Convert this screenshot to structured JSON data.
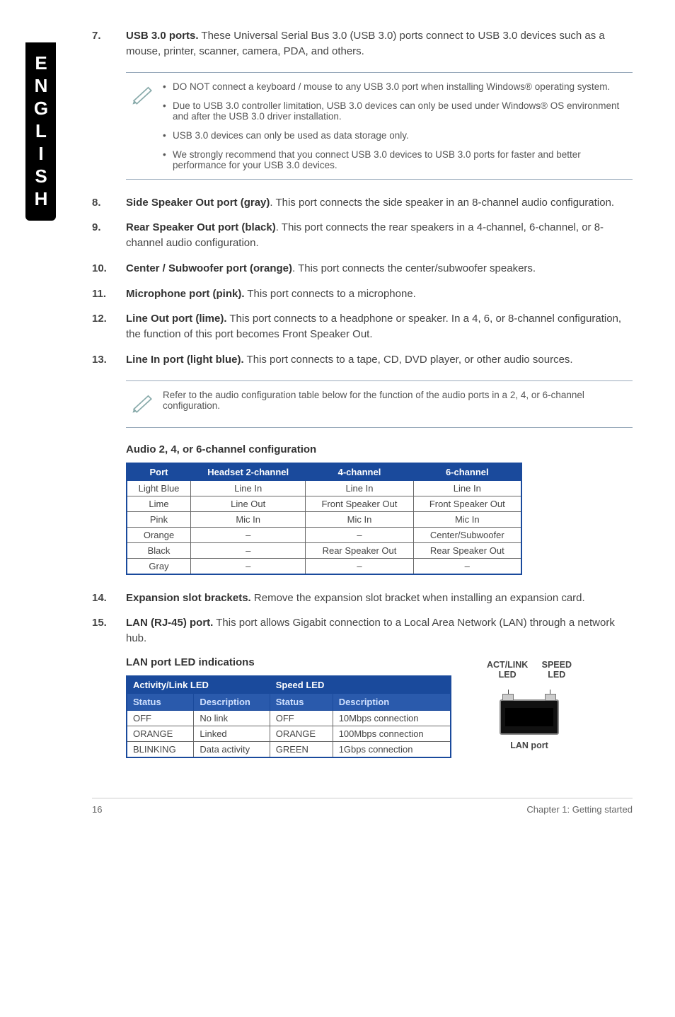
{
  "sideTab": "ENGLISH",
  "items": [
    {
      "num": "7.",
      "title": "USB 3.0 ports.",
      "text": " These Universal Serial Bus 3.0 (USB 3.0) ports connect to USB 3.0 devices such as a mouse, printer, scanner, camera, PDA, and others."
    },
    {
      "num": "8.",
      "title": "Side Speaker Out port (gray)",
      "text": ". This port connects the side speaker in an 8-channel audio configuration."
    },
    {
      "num": "9.",
      "title": "Rear Speaker Out port (black)",
      "text": ". This port connects the rear speakers in a 4-channel, 6-channel, or 8-channel audio configuration."
    },
    {
      "num": "10.",
      "title": "Center / Subwoofer port (orange)",
      "text": ". This port connects the center/subwoofer speakers."
    },
    {
      "num": "11.",
      "title": "Microphone port (pink).",
      "text": " This port connects to a microphone."
    },
    {
      "num": "12.",
      "title": "Line Out port (lime).",
      "text": " This port connects to a headphone or speaker. In a 4, 6, or 8-channel configuration, the function of this port becomes Front Speaker Out."
    },
    {
      "num": "13.",
      "title": "Line In port (light blue).",
      "text": " This port connects to a tape, CD, DVD player, or other audio sources."
    },
    {
      "num": "14.",
      "title": "Expansion slot brackets.",
      "text": " Remove the expansion slot bracket when installing an expansion card."
    },
    {
      "num": "15.",
      "title": "LAN (RJ-45) port.",
      "text": " This port allows Gigabit connection to a Local Area Network (LAN) through a network hub."
    }
  ],
  "note1": [
    "DO NOT connect a keyboard / mouse to any USB 3.0 port when installing Windows® operating system.",
    "Due to USB 3.0 controller limitation, USB 3.0 devices can only be used under Windows® OS environment and after the USB 3.0 driver installation.",
    "USB 3.0 devices can only be used as data storage only.",
    "We strongly recommend that you connect USB 3.0 devices to USB 3.0 ports for faster and better performance for your USB 3.0 devices."
  ],
  "note2": "Refer to the audio configuration table below for the function of the audio ports in a 2, 4, or 6-channel configuration.",
  "audioHeading": "Audio 2, 4, or 6-channel configuration",
  "audioTable": {
    "headers": [
      "Port",
      "Headset 2-channel",
      "4-channel",
      "6-channel"
    ],
    "rows": [
      [
        "Light Blue",
        "Line In",
        "Line In",
        "Line In"
      ],
      [
        "Lime",
        "Line Out",
        "Front Speaker Out",
        "Front Speaker Out"
      ],
      [
        "Pink",
        "Mic In",
        "Mic In",
        "Mic In"
      ],
      [
        "Orange",
        "–",
        "–",
        "Center/Subwoofer"
      ],
      [
        "Black",
        "–",
        "Rear Speaker Out",
        "Rear Speaker Out"
      ],
      [
        "Gray",
        "–",
        "–",
        "–"
      ]
    ]
  },
  "lanHeading": "LAN port LED indications",
  "lanTable": {
    "top": [
      "Activity/Link LED",
      "Speed LED"
    ],
    "sub": [
      "Status",
      "Description",
      "Status",
      "Description"
    ],
    "rows": [
      [
        "OFF",
        "No link",
        "OFF",
        "10Mbps connection"
      ],
      [
        "ORANGE",
        "Linked",
        "ORANGE",
        "100Mbps connection"
      ],
      [
        "BLINKING",
        "Data activity",
        "GREEN",
        "1Gbps connection"
      ]
    ]
  },
  "lanDiagram": {
    "left": "ACT/LINK LED",
    "right": "SPEED LED",
    "caption": "LAN port"
  },
  "footer": {
    "page": "16",
    "chapter": "Chapter 1: Getting started"
  }
}
